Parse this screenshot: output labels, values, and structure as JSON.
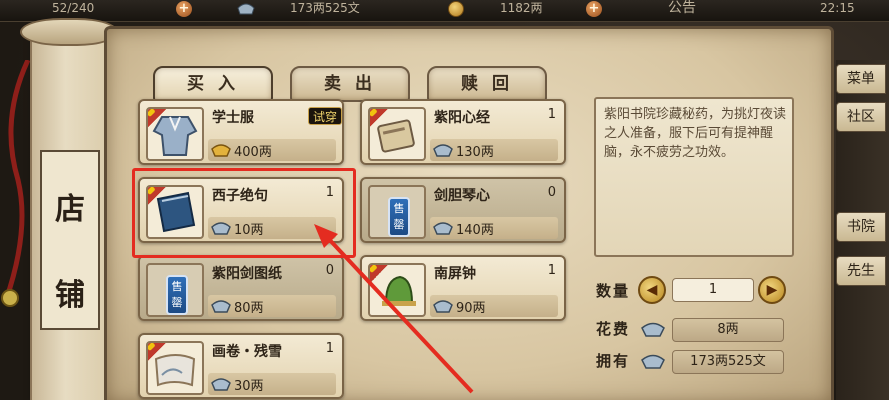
{
  "hud": {
    "level_fragment": "52/240",
    "silver": "173两525文",
    "gold": "1182两",
    "notice": "公告",
    "clock": "22:15"
  },
  "scroll": {
    "char_1": "店",
    "char_2": "铺"
  },
  "tabs": [
    {
      "label": "买 入",
      "active": true
    },
    {
      "label": "卖 出",
      "active": false
    },
    {
      "label": "赎 回",
      "active": false
    }
  ],
  "items": [
    {
      "name": "学士服",
      "qty": "",
      "price": "400两",
      "currency": "gold-ingot-icon",
      "badge": "试穿",
      "sold": false,
      "thumb": "robe-icon"
    },
    {
      "name": "紫阳心经",
      "qty": "1",
      "price": "130两",
      "currency": "silver-ingot-icon",
      "badge": "",
      "sold": false,
      "thumb": "scroll-book-icon"
    },
    {
      "name": "西子绝句",
      "qty": "1",
      "price": "10两",
      "currency": "silver-ingot-icon",
      "badge": "",
      "sold": false,
      "thumb": "blue-book-icon"
    },
    {
      "name": "剑胆琴心",
      "qty": "0",
      "price": "140两",
      "currency": "silver-ingot-icon",
      "badge": "",
      "sold": true,
      "sold_label": "售罄",
      "thumb": "book-icon"
    },
    {
      "name": "紫阳剑图纸",
      "qty": "0",
      "price": "80两",
      "currency": "silver-ingot-icon",
      "badge": "",
      "sold": true,
      "sold_label": "售罄",
      "thumb": "blueprint-icon"
    },
    {
      "name": "南屏钟",
      "qty": "1",
      "price": "90两",
      "currency": "silver-ingot-icon",
      "badge": "",
      "sold": false,
      "thumb": "bell-icon"
    },
    {
      "name": "画卷・残雪",
      "qty": "1",
      "price": "30两",
      "currency": "silver-ingot-icon",
      "badge": "",
      "sold": false,
      "thumb": "painting-icon"
    }
  ],
  "description": "紫阳书院珍藏秘药，为挑灯夜读之人准备，服下后可有提神醒脑，永不疲劳之功效。",
  "purchase": {
    "qty_label": "数量",
    "qty_value": "1",
    "cost_label": "花费",
    "cost_value": "8两",
    "own_label": "拥有",
    "own_value": "173两525文"
  },
  "right_strip": [
    "菜单",
    "社区",
    "书院",
    "先生"
  ],
  "colors": {
    "highlight": "#e42c20",
    "panel": "#d8c6a2",
    "sold_tag": "#2f6fb8"
  }
}
